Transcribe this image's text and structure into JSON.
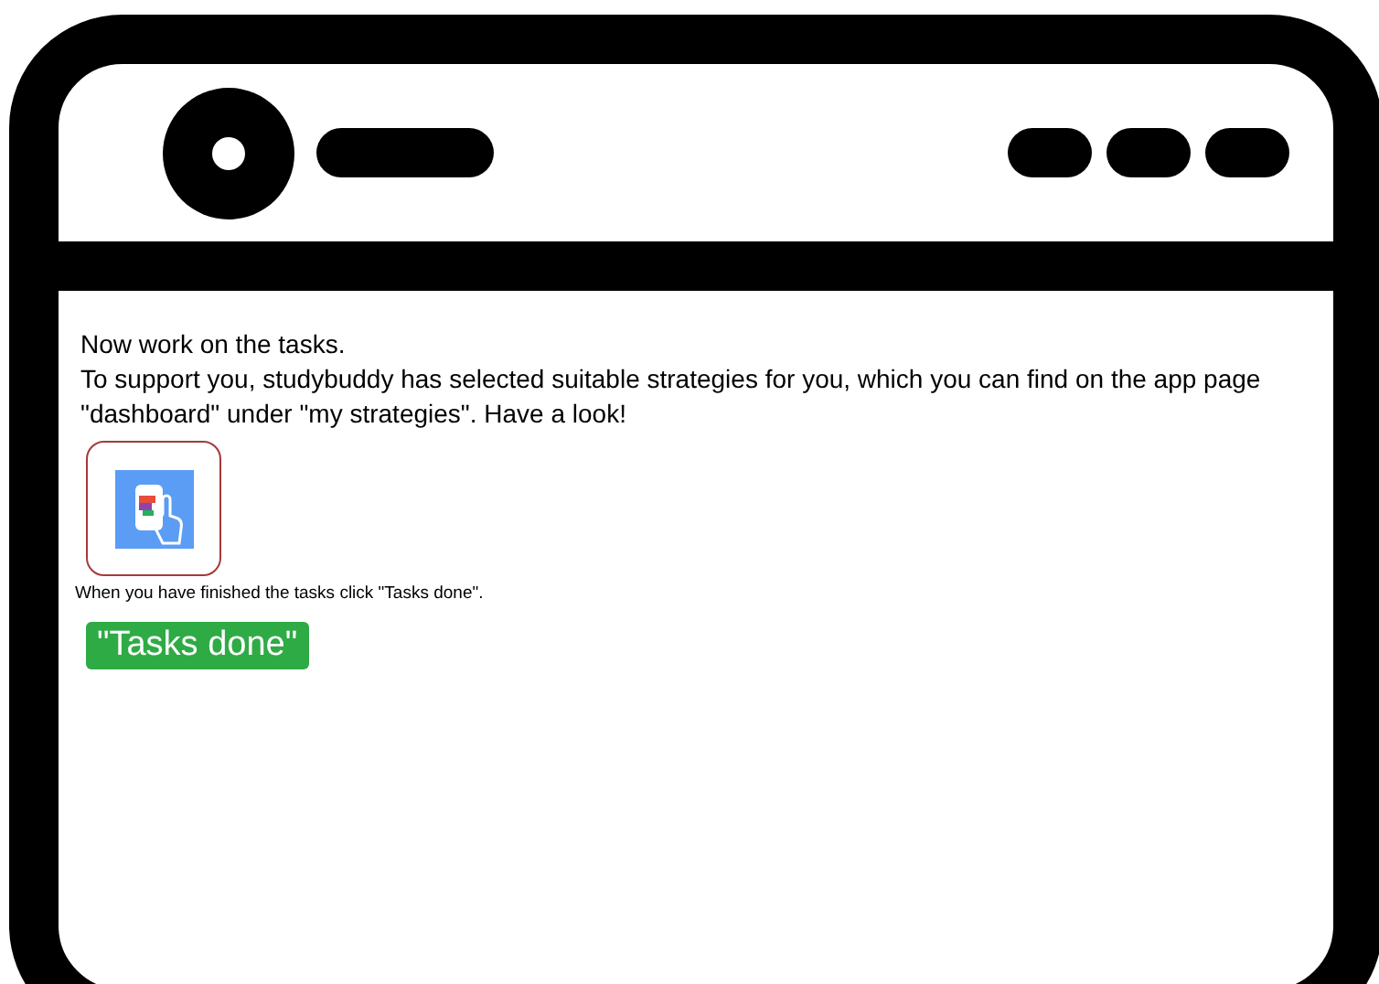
{
  "content": {
    "lines": [
      "Now work on the tasks.",
      "To support you, studybuddy has selected suitable strategies for you, which you can find on the app page \"dashboard\" under \"my strategies\". Have a look!"
    ],
    "note": "When you have finished the tasks click \"Tasks done\".",
    "button": "\"Tasks done\""
  }
}
